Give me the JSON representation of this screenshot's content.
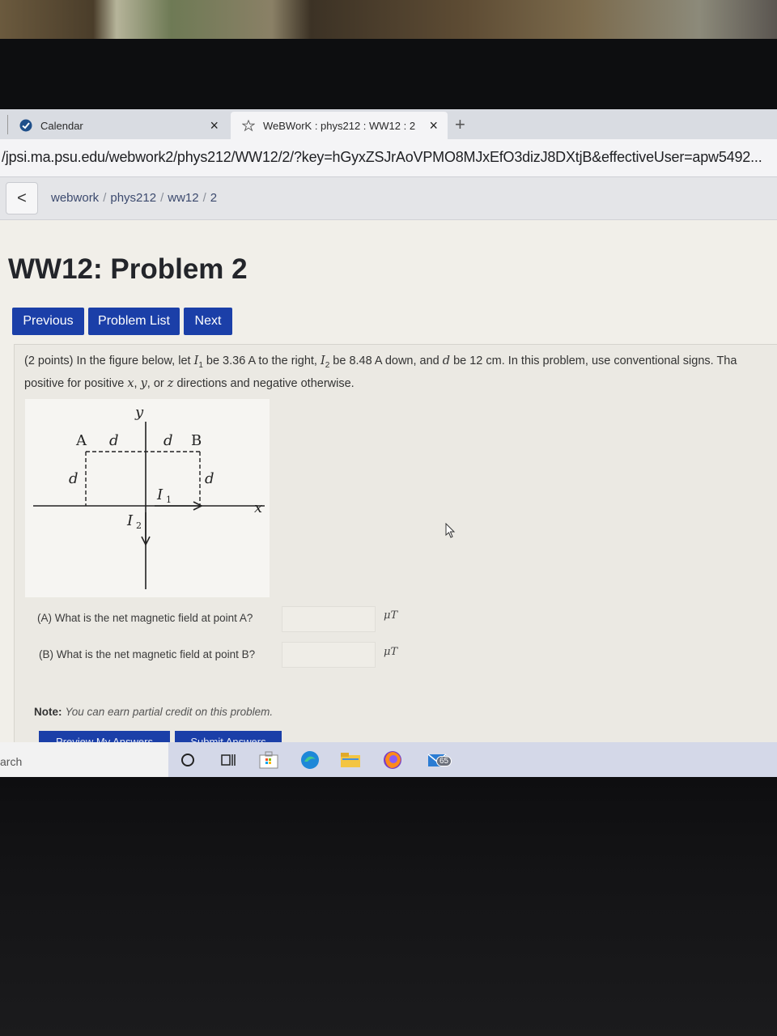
{
  "browser": {
    "tabs": [
      {
        "title": "Calendar",
        "icon": "calendar-favicon",
        "close": "×"
      },
      {
        "title": "WeBWorK : phys212 : WW12 : 2",
        "icon": "webwork-favicon",
        "close": "×"
      }
    ],
    "new_tab": "+",
    "url": "/jpsi.ma.psu.edu/webwork2/phys212/WW12/2/?key=hGyxZSJrAoVPMO8MJxEfO3dizJ8DXtjB&effectiveUser=apw5492..."
  },
  "breadcrumb": {
    "back": "<",
    "items": [
      "webwork",
      "phys212",
      "ww12",
      "2"
    ],
    "separator": "/"
  },
  "page": {
    "title": "WW12: Problem 2",
    "nav": {
      "previous": "Previous",
      "problem_list": "Problem List",
      "next": "Next"
    }
  },
  "problem": {
    "p1": "(2 points) In the figure below, let ",
    "i1": "I",
    "i1_sub": "1",
    "p2": " be 3.36 A to the right, ",
    "i2": "I",
    "i2_sub": "2",
    "p3": " be 8.48 A down, and ",
    "d": "d",
    "p4": " be 12 cm. In this problem, use conventional signs. Tha",
    "line2_a": "positive for positive ",
    "x": "x",
    "sep1": ", ",
    "y": "y",
    "sep2": ", or ",
    "z": "z",
    "line2_b": " directions and negative otherwise.",
    "figure": {
      "y_axis": "y",
      "x_axis": "x",
      "point_a": "A",
      "point_b": "B",
      "d_label": "d",
      "i1_label": "I",
      "i1_sub": "1",
      "i2_label": "I",
      "i2_sub": "2"
    },
    "questions": [
      {
        "label": "(A) What is the net magnetic field at point A?",
        "value": "",
        "unit": "μT"
      },
      {
        "label": "(B) What is the net magnetic field at point B?",
        "value": "",
        "unit": "μT"
      }
    ],
    "note_label": "Note:",
    "note_body": "You can earn partial credit on this problem.",
    "preview_button": "Preview My Answers",
    "submit_button": "Submit Answers"
  },
  "taskbar": {
    "search_stub": "arch",
    "icons": [
      "cortana-icon",
      "task-view-icon",
      "store-icon",
      "edge-icon",
      "file-explorer-icon",
      "firefox-icon",
      "mail-icon"
    ],
    "mail_badge": "65"
  },
  "colors": {
    "accent": "#1b3fa8",
    "page_bg": "#f1efe9",
    "bezel": "#0c0c0d"
  }
}
